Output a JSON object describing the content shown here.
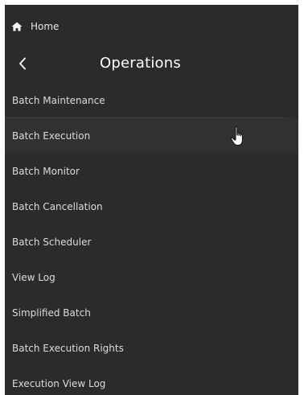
{
  "nav": {
    "home_label": "Home",
    "home_icon": "home-icon"
  },
  "header": {
    "back_icon": "chevron-left-icon",
    "title": "Operations"
  },
  "menu": {
    "items": [
      {
        "label": "Batch Maintenance"
      },
      {
        "label": "Batch Execution"
      },
      {
        "label": "Batch Monitor"
      },
      {
        "label": "Batch Cancellation"
      },
      {
        "label": "Batch Scheduler"
      },
      {
        "label": "View Log"
      },
      {
        "label": "Simplified Batch"
      },
      {
        "label": "Batch Execution Rights"
      },
      {
        "label": "Execution View Log"
      }
    ]
  },
  "colors": {
    "background": "#2b2b2b",
    "text": "#dcdcdc",
    "title": "#ffffff"
  },
  "pointer": {
    "icon": "hand-pointer-icon"
  }
}
